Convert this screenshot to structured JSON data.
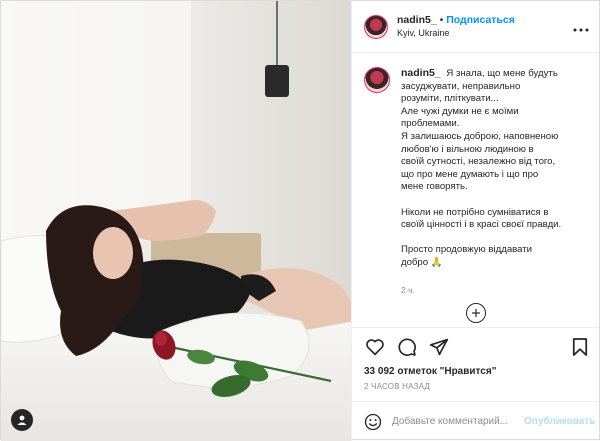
{
  "header": {
    "username": "nadin5_",
    "separator": "•",
    "follow_label": "Подписаться",
    "location": "Kyiv, Ukraine",
    "more_icon": "more-horizontal-icon"
  },
  "caption": {
    "username": "nadin5_",
    "lines": [
      "Я знала, що мене будуть",
      "засуджувати, неправильно",
      "розуміти, пліткувати...",
      "Але чужі думки не є моїми",
      "проблемами.",
      "Я залишаюсь доброю, наповненою",
      "любов'ю і вільною людиною в",
      "своїй сутності, незалежно від того,",
      "що про мене думають і що про",
      "мене говорять.",
      "",
      "Ніколи не потрібно сумніватися в",
      "своїй цінності і в красі своєї правди.",
      "",
      "Просто продовжую віддавати",
      "добро 🙏"
    ],
    "time": "2 ч."
  },
  "actions": {
    "like_icon": "heart-icon",
    "comment_icon": "comment-icon",
    "share_icon": "share-icon",
    "save_icon": "bookmark-icon"
  },
  "likes_text": "33 092 отметок \"Нравится\"",
  "posted_ago": "2 ЧАСОВ НАЗАД",
  "comment_box": {
    "placeholder": "Добавьте комментарий...",
    "publish_label": "Опубликовать",
    "emoji_icon": "emoji-icon"
  },
  "colors": {
    "accent": "#0095f6",
    "publish_disabled": "#b2dffc",
    "muted": "#8e8e8e",
    "text": "#262626"
  }
}
